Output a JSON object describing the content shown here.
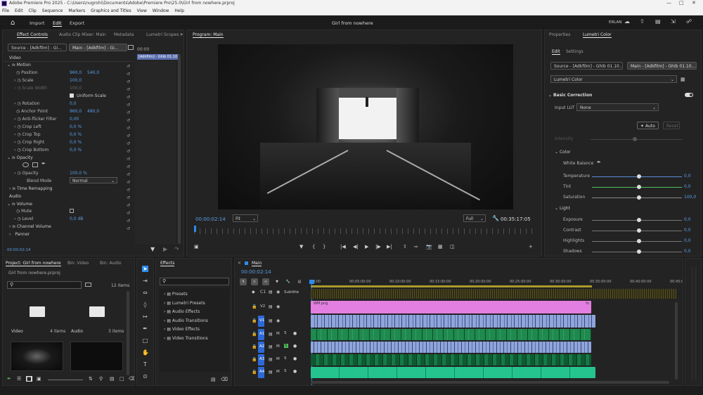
{
  "app": {
    "title": "Adobe Premiere Pro 2025 - C:\\Users\\nugrohi\\Documents\\Adobe\\Premiere Pro\\25.0\\Girl from nowhere.prproj"
  },
  "menu": [
    "File",
    "Edit",
    "Clip",
    "Sequence",
    "Markers",
    "Graphics and Titles",
    "View",
    "Window",
    "Help"
  ],
  "header": {
    "tabs": [
      "Import",
      "Edit",
      "Export"
    ],
    "project_title": "Girl from nowhere",
    "user": "ERLAN"
  },
  "effect_controls": {
    "tabs": [
      "Effect Controls",
      "Audio Clip Mixer: Main",
      "Metadata",
      "Lumetri Scopes"
    ],
    "source_label": "Source - [Adkfilm] - Gi...",
    "main_label": "Main - [Adkfilm] - Gi...",
    "clip_label": "[Adkfilm] - Ghib 01.10...",
    "time_label": "00:00",
    "section_video": "Video",
    "section_audio": "Audio",
    "motion": "Motion",
    "position": "Position",
    "pos_x": "960,0",
    "pos_y": "540,0",
    "scale": "Scale",
    "scale_val": "100,0",
    "scale_width": "Scale Width",
    "scale_width_val": "100,0",
    "uniform": "Uniform Scale",
    "rotation": "Rotation",
    "rotation_val": "0,0",
    "anchor": "Anchor Point",
    "anchor_x": "960,0",
    "anchor_y": "480,0",
    "antiflicker": "Anti-flicker Filter",
    "antiflicker_val": "0,00",
    "crop_left": "Crop Left",
    "crop_left_val": "0,0 %",
    "crop_top": "Crop Top",
    "crop_top_val": "0,0 %",
    "crop_right": "Crop Right",
    "crop_right_val": "0,0 %",
    "crop_bottom": "Crop Bottom",
    "crop_bottom_val": "0,0 %",
    "opacity": "Opacity",
    "opacity_prop": "Opacity",
    "opacity_val": "100,0 %",
    "blend": "Blend Mode",
    "blend_val": "Normal",
    "time_remap": "Time Remapping",
    "volume": "Volume",
    "mute": "Mute",
    "level": "Level",
    "level_val": "0,0 dB",
    "channel_volume": "Channel Volume",
    "panner": "Panner",
    "timecode": "00:00:02:14"
  },
  "program": {
    "tab": "Program: Main",
    "timecode": "00:00:02:14",
    "fit": "Fit",
    "quality": "Full",
    "duration": "00:35:17:05"
  },
  "lumetri": {
    "tabs": [
      "Properties",
      "Lumetri Color"
    ],
    "subtabs": [
      "Edit",
      "Settings"
    ],
    "source_label": "Source - [Adkfilm] - Ghib 01.10...",
    "main_label": "Main - [Adkfilm] - Ghib 01.10...",
    "effect_select": "Lumetri Color",
    "basic": "Basic Correction",
    "input_lut": "Input LUT",
    "lut_val": "None",
    "auto": "Auto",
    "reset": "Reset",
    "intensity": "Intensity",
    "color_section": "Color",
    "white_balance": "White Balance",
    "color_sliders": [
      {
        "label": "Temperature",
        "value": "0,0",
        "track": "#5a8ad8",
        "pct": 0.52
      },
      {
        "label": "Tint",
        "value": "0,0",
        "track": "#4fbf5a",
        "pct": 0.52
      },
      {
        "label": "Saturation",
        "value": "100,0",
        "track": "#888888",
        "pct": 0.52
      }
    ],
    "light_section": "Light",
    "light_sliders": [
      {
        "label": "Exposure",
        "value": "0,0",
        "pct": 0.52
      },
      {
        "label": "Contrast",
        "value": "0,0",
        "pct": 0.52
      },
      {
        "label": "Highlights",
        "value": "0,0",
        "pct": 0.52
      },
      {
        "label": "Shadows",
        "value": "0,0",
        "pct": 0.52
      }
    ]
  },
  "project": {
    "tabs": [
      "Project: Girl from nowhere",
      "Bin: Video",
      "Bin: Audio"
    ],
    "file": "Girl from nowhere.prproj",
    "count": "12 items",
    "bins": [
      {
        "name": "Video",
        "count": "4 items"
      },
      {
        "name": "Audio",
        "count": "3 items"
      }
    ]
  },
  "effects": {
    "tab": "Effects",
    "items": [
      "Presets",
      "Lumetri Presets",
      "Audio Effects",
      "Audio Transitions",
      "Video Effects",
      "Video Transitions"
    ]
  },
  "timeline": {
    "tab": "Main",
    "timecode": "00:00:02:14",
    "ruler": [
      ":00:00",
      "00:05:00:00",
      "00:10:00:00",
      "00:15:00:00",
      "00:20:00:00",
      "00:25:00:00",
      "00:30:00:00",
      "00:35:00:00",
      "00:40:00:00",
      "00:45:0"
    ],
    "subtitle": "Subtitle",
    "image_clip": "WM.png",
    "fx": "fx",
    "video_tracks": [
      "V2",
      "V1"
    ],
    "audio_tracks": [
      "A1",
      "A2",
      "A3",
      "A4"
    ]
  },
  "colors": {
    "accent": "#2d8ceb",
    "pink": "#e27fe0",
    "blue_clip": "#8fa5dc",
    "green_clip": "#1e8a4e",
    "teal_clip": "#25c48e"
  }
}
